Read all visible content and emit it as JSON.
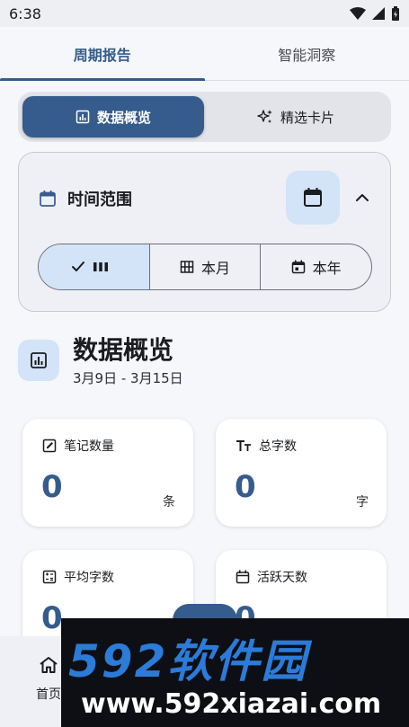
{
  "status_bar": {
    "time": "6:38"
  },
  "tabs": [
    {
      "label": "周期报告",
      "active": true
    },
    {
      "label": "智能洞察",
      "active": false
    }
  ],
  "view_toggle": {
    "overview_label": "数据概览",
    "cards_label": "精选卡片"
  },
  "time_range": {
    "title": "时间范围",
    "options": [
      {
        "label": "",
        "selected": true
      },
      {
        "label": "本月",
        "selected": false
      },
      {
        "label": "本年",
        "selected": false
      }
    ]
  },
  "section": {
    "title": "数据概览",
    "date_range": "3月9日 - 3月15日"
  },
  "stats": [
    {
      "label": "笔记数量",
      "value": "0",
      "unit": "条",
      "icon": "edit-note-icon"
    },
    {
      "label": "总字数",
      "value": "0",
      "unit": "字",
      "icon": "text-size-icon"
    },
    {
      "label": "平均字数",
      "value": "0",
      "unit": "",
      "icon": "calculator-icon"
    },
    {
      "label": "活跃天数",
      "value": "0",
      "unit": "",
      "icon": "calendar-icon"
    }
  ],
  "bottom_nav": {
    "home_label": "首页"
  },
  "watermark": {
    "logo": "592软件园",
    "url": "www.592xiazai.com"
  },
  "colors": {
    "primary": "#355c8c",
    "primary_container": "#d3e3f8",
    "surface": "#f6f7fb"
  }
}
